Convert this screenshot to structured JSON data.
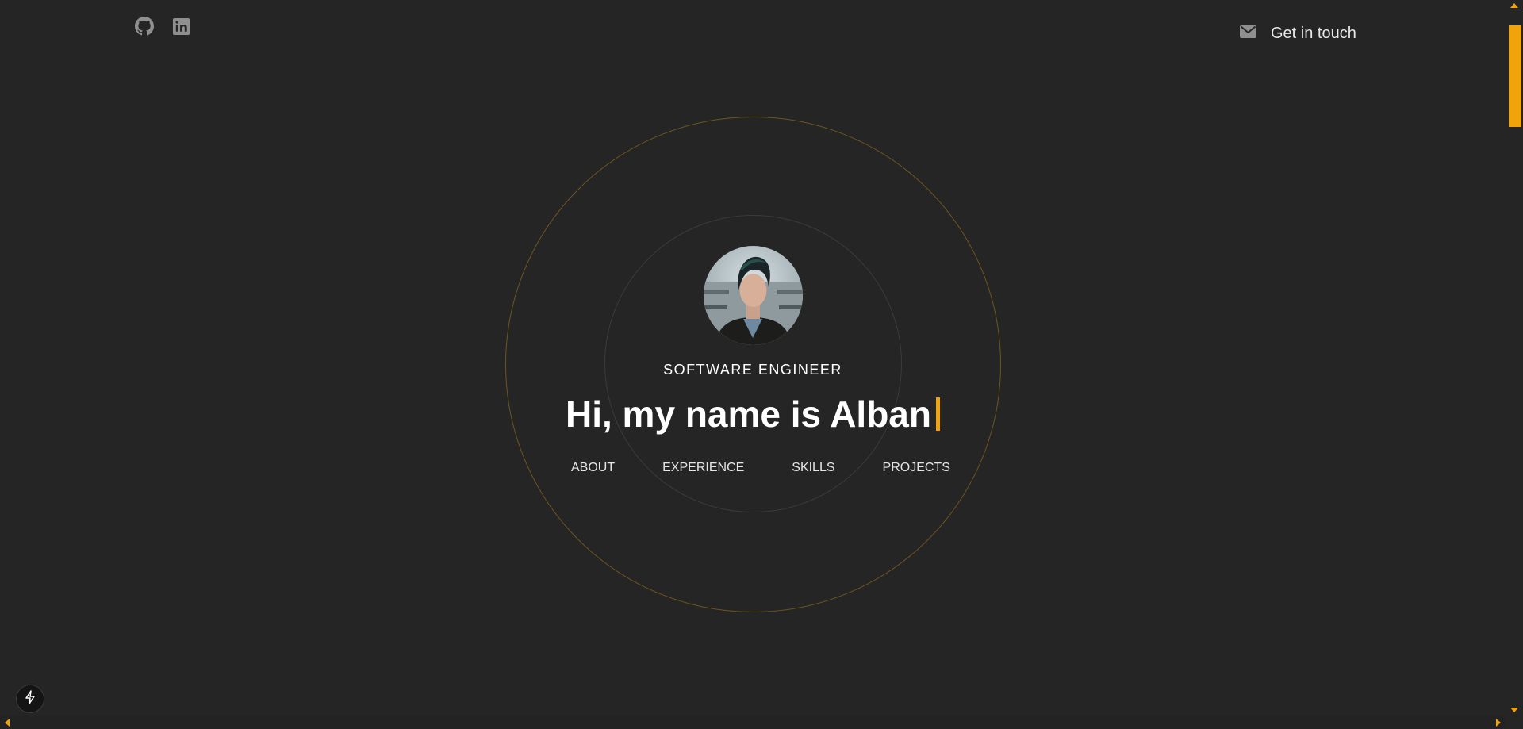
{
  "header": {
    "social": [
      {
        "icon": "github-icon",
        "label": "GitHub"
      },
      {
        "icon": "linkedin-icon",
        "label": "LinkedIn"
      }
    ],
    "contact": {
      "icon": "mail-icon",
      "label": "Get in touch"
    }
  },
  "hero": {
    "avatar_alt": "Profile photo",
    "role": "SOFTWARE ENGINEER",
    "greeting": "Hi, my name is Alban",
    "nav": [
      "ABOUT",
      "EXPERIENCE",
      "SKILLS",
      "PROJECTS"
    ]
  },
  "fab": {
    "icon": "lightning-icon"
  },
  "colors": {
    "background": "#252525",
    "accent": "#f0a30a",
    "text": "#ffffff"
  }
}
